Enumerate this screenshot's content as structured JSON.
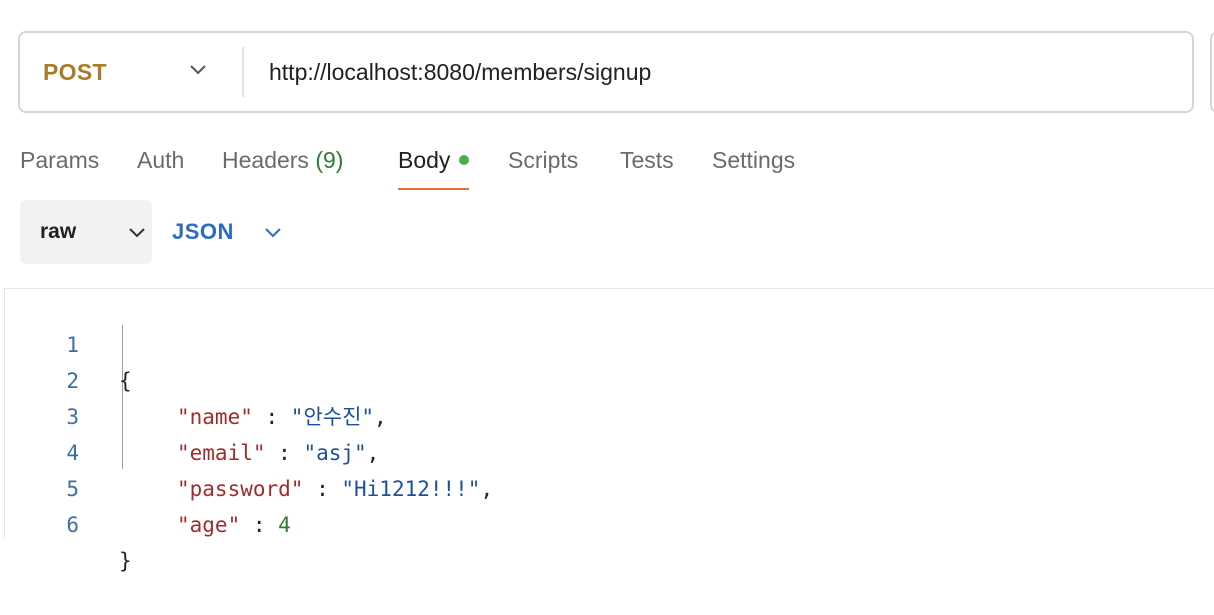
{
  "request": {
    "method": "POST",
    "url": "http://localhost:8080/members/signup"
  },
  "tabs": [
    {
      "label": "Params"
    },
    {
      "label": "Auth"
    },
    {
      "label": "Headers",
      "count": "(9)"
    },
    {
      "label": "Body",
      "active": true
    },
    {
      "label": "Scripts"
    },
    {
      "label": "Tests"
    },
    {
      "label": "Settings"
    }
  ],
  "body_options": {
    "mode": "raw",
    "language": "JSON"
  },
  "editor": {
    "line_numbers": [
      "1",
      "2",
      "3",
      "4",
      "5",
      "6"
    ],
    "open_brace": "{",
    "close_brace": "}",
    "fields": [
      {
        "key": "\"name\"",
        "sep": " : ",
        "value": "\"안수진\"",
        "trail": ","
      },
      {
        "key": "\"email\"",
        "sep": " : ",
        "value": "\"asj\"",
        "trail": ","
      },
      {
        "key": "\"password\"",
        "sep": " : ",
        "value": "\"Hi1212!!!\"",
        "trail": ","
      },
      {
        "key": "\"age\"",
        "sep": " : ",
        "value": "4",
        "trail": ""
      }
    ]
  },
  "icons": {
    "method_dropdown": "chevron-down-icon",
    "mode_dropdown": "chevron-down-icon",
    "language_dropdown": "chevron-down-icon",
    "body_indicator": "dot-icon"
  },
  "colors": {
    "method": "#a87c28",
    "active_tab_underline": "#e8703a",
    "body_dot": "#4caf50",
    "json_label": "#2d6bc4",
    "json_key": "#a52a2a",
    "json_string": "#1f4fa0",
    "json_number": "#2e7d32"
  }
}
